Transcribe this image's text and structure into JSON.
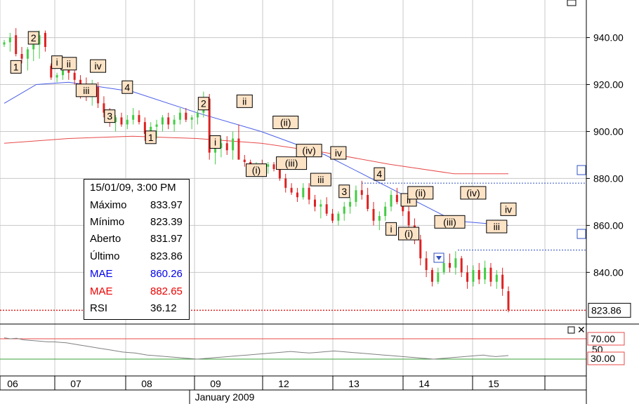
{
  "chart_data": {
    "type": "candlestick",
    "y_axis": {
      "ticks": [
        "940.00",
        "920.00",
        "900.00",
        "880.00",
        "860.00",
        "840.00"
      ],
      "min": 818,
      "max": 956
    },
    "x_axis": {
      "ticks": [
        "06",
        "07",
        "08",
        "09",
        "12",
        "13",
        "14",
        "15"
      ],
      "month_label": "January 2009"
    },
    "last_price_label": "823.86",
    "rsi_panel": {
      "levels": [
        "70.00",
        "30.00"
      ],
      "partial_label": "50"
    },
    "info_box": {
      "datetime": "15/01/09, 3:00 PM",
      "rows": [
        {
          "label": "Máximo",
          "value": "833.97",
          "color": "#000000"
        },
        {
          "label": "Mínimo",
          "value": "823.39",
          "color": "#000000"
        },
        {
          "label": "Aberto",
          "value": "831.97",
          "color": "#000000"
        },
        {
          "label": "Último",
          "value": "823.86",
          "color": "#000000"
        },
        {
          "label": "MAE",
          "value": "860.26",
          "color": "#0000ee"
        },
        {
          "label": "MAE",
          "value": "882.65",
          "color": "#ee0000"
        },
        {
          "label": "RSI",
          "value": "36.12",
          "color": "#000000"
        }
      ]
    },
    "candles": [
      [
        937,
        939,
        936,
        938
      ],
      [
        938,
        942,
        934,
        940
      ],
      [
        941,
        944,
        932,
        933
      ],
      [
        933,
        936,
        929,
        931
      ],
      [
        931,
        936,
        926,
        935
      ],
      [
        935,
        938,
        930,
        937
      ],
      [
        937,
        943,
        931,
        941
      ],
      [
        942,
        943,
        934,
        936
      ],
      [
        928,
        929,
        922,
        923
      ],
      [
        923,
        925,
        921,
        924
      ],
      [
        924,
        928,
        922,
        926
      ],
      [
        926,
        927,
        922,
        925
      ],
      [
        925,
        926,
        920,
        922
      ],
      [
        922,
        924,
        914,
        918
      ],
      [
        919,
        923,
        913,
        915
      ],
      [
        916,
        922,
        911,
        920
      ],
      [
        919,
        921,
        910,
        912
      ],
      [
        912,
        915,
        906,
        908
      ],
      [
        908,
        910,
        902,
        904
      ],
      [
        904,
        907,
        900,
        906
      ],
      [
        906,
        908,
        902,
        903
      ],
      [
        903,
        907,
        901,
        905
      ],
      [
        905,
        910,
        903,
        907
      ],
      [
        907,
        909,
        903,
        904
      ],
      [
        904,
        906,
        896,
        899
      ],
      [
        899,
        904,
        896,
        902
      ],
      [
        902,
        905,
        897,
        903
      ],
      [
        903,
        907,
        900,
        906
      ],
      [
        906,
        908,
        901,
        903
      ],
      [
        903,
        907,
        900,
        905
      ],
      [
        905,
        910,
        903,
        908
      ],
      [
        908,
        910,
        904,
        905
      ],
      [
        905,
        907,
        901,
        906
      ],
      [
        906,
        909,
        903,
        908
      ],
      [
        908,
        917,
        906,
        913
      ],
      [
        914,
        916,
        888,
        891
      ],
      [
        891,
        896,
        886,
        893
      ],
      [
        893,
        897,
        889,
        895
      ],
      [
        895,
        898,
        890,
        892
      ],
      [
        892,
        900,
        888,
        897
      ],
      [
        897,
        903,
        891,
        888
      ],
      [
        888,
        890,
        885,
        887
      ],
      [
        887,
        888,
        883,
        885
      ],
      [
        885,
        887,
        881,
        886
      ],
      [
        886,
        888,
        884,
        885
      ],
      [
        885,
        887,
        882,
        886
      ],
      [
        886,
        887,
        883,
        884
      ],
      [
        884,
        886,
        879,
        880
      ],
      [
        880,
        882,
        874,
        876
      ],
      [
        876,
        878,
        873,
        874
      ],
      [
        874,
        876,
        870,
        872
      ],
      [
        872,
        878,
        871,
        876
      ],
      [
        876,
        878,
        869,
        871
      ],
      [
        871,
        873,
        866,
        868
      ],
      [
        868,
        871,
        863,
        869
      ],
      [
        869,
        872,
        864,
        865
      ],
      [
        865,
        867,
        861,
        862
      ],
      [
        862,
        866,
        860,
        865
      ],
      [
        865,
        870,
        862,
        868
      ],
      [
        868,
        872,
        865,
        870
      ],
      [
        870,
        877,
        868,
        875
      ],
      [
        875,
        879,
        871,
        873
      ],
      [
        873,
        876,
        866,
        867
      ],
      [
        867,
        870,
        860,
        862
      ],
      [
        862,
        866,
        858,
        864
      ],
      [
        864,
        870,
        862,
        868
      ],
      [
        868,
        875,
        866,
        873
      ],
      [
        873,
        876,
        869,
        870
      ],
      [
        870,
        872,
        864,
        866
      ],
      [
        866,
        868,
        858,
        860
      ],
      [
        860,
        863,
        852,
        854
      ],
      [
        854,
        856,
        843,
        846
      ],
      [
        846,
        849,
        838,
        841
      ],
      [
        841,
        842,
        834,
        836
      ],
      [
        836,
        842,
        835,
        840
      ],
      [
        840,
        846,
        839,
        844
      ],
      [
        844,
        848,
        840,
        842
      ],
      [
        842,
        849,
        839,
        846
      ],
      [
        846,
        847,
        838,
        840
      ],
      [
        840,
        843,
        833,
        836
      ],
      [
        836,
        843,
        834,
        841
      ],
      [
        841,
        844,
        835,
        837
      ],
      [
        837,
        845,
        835,
        842
      ],
      [
        842,
        844,
        834,
        836
      ],
      [
        836,
        841,
        833,
        839
      ],
      [
        839,
        842,
        830,
        833
      ],
      [
        832,
        834,
        823,
        824
      ]
    ],
    "ma_blue": [
      [
        0,
        912
      ],
      [
        10,
        920
      ],
      [
        20,
        921
      ],
      [
        40,
        917
      ],
      [
        60,
        908
      ],
      [
        80,
        900
      ],
      [
        100,
        890
      ],
      [
        120,
        876
      ],
      [
        140,
        862
      ],
      [
        157,
        860
      ]
    ],
    "ma_red": [
      [
        0,
        895
      ],
      [
        20,
        897
      ],
      [
        40,
        898
      ],
      [
        60,
        897
      ],
      [
        80,
        895
      ],
      [
        100,
        891
      ],
      [
        120,
        886
      ],
      [
        140,
        882
      ],
      [
        157,
        882
      ]
    ],
    "wave_labels": [
      {
        "t": "2",
        "i": 4
      },
      {
        "t": "1",
        "i": 2
      },
      {
        "t": "ii",
        "i": 9
      },
      {
        "t": "i",
        "i": 7
      },
      {
        "t": "iv",
        "i": 13
      },
      {
        "t": "iii",
        "i": 11
      },
      {
        "t": "4",
        "i": 17
      },
      {
        "t": "3",
        "i": 15
      },
      {
        "t": "1",
        "i": 20
      },
      {
        "t": "2",
        "i": 28
      },
      {
        "t": "i",
        "i": 29
      },
      {
        "t": "ii",
        "i": 33
      },
      {
        "t": "(ii)",
        "i": 39
      },
      {
        "t": "(i)",
        "i": 35
      },
      {
        "t": "(iv)",
        "i": 42
      },
      {
        "t": "(iii)",
        "i": 40
      },
      {
        "t": "iv",
        "i": 46
      },
      {
        "t": "iii",
        "i": 44
      },
      {
        "t": "3",
        "i": 47
      },
      {
        "t": "4",
        "i": 52
      },
      {
        "t": "i",
        "i": 54
      },
      {
        "t": "ii",
        "i": 56
      },
      {
        "t": "(ii)",
        "i": 58
      },
      {
        "t": "(i)",
        "i": 56
      },
      {
        "t": "(iv)",
        "i": 65
      },
      {
        "t": "(iii)",
        "i": 62
      },
      {
        "t": "iv",
        "i": 70
      },
      {
        "t": "iii",
        "i": 68
      }
    ],
    "rsi_series": [
      72,
      70,
      71,
      68,
      67,
      66,
      65,
      64,
      64,
      63,
      62,
      60,
      58,
      56,
      54,
      52,
      50,
      48,
      46,
      44,
      43,
      42,
      40,
      38,
      37,
      36,
      35,
      34,
      33,
      32,
      31,
      30,
      31,
      32,
      33,
      34,
      35,
      36,
      37,
      38,
      39,
      40,
      41,
      42,
      43,
      44,
      45,
      44,
      43,
      42,
      43,
      44,
      45,
      46,
      45,
      44,
      43,
      42,
      41,
      40,
      39,
      38,
      37,
      36,
      35,
      34,
      33,
      32,
      31,
      30,
      31,
      32,
      33,
      34,
      35,
      36,
      37,
      38,
      36,
      35,
      36,
      37
    ]
  }
}
